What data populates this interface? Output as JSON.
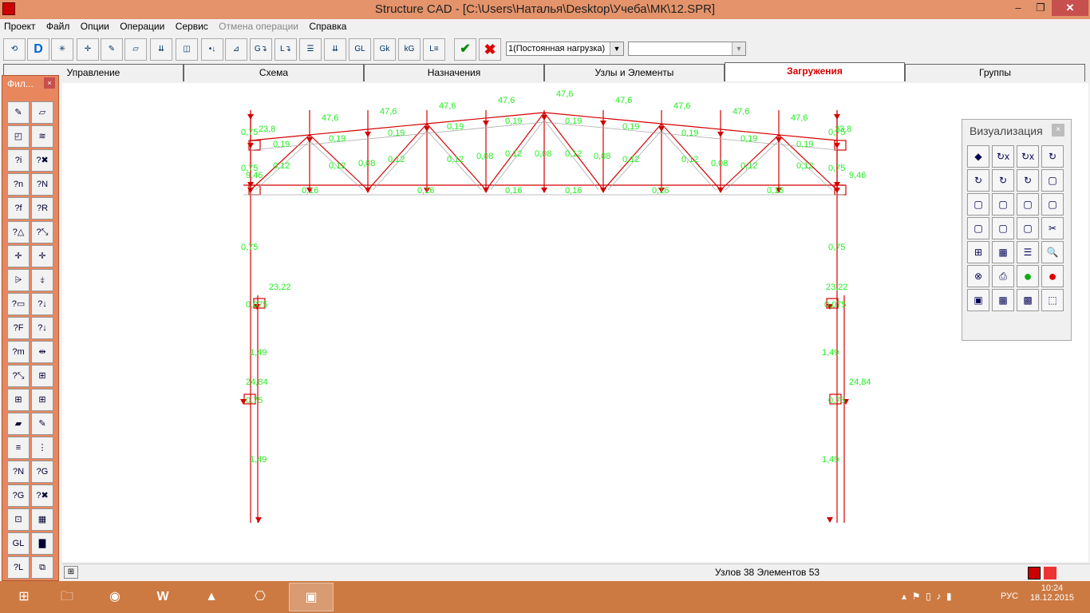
{
  "window": {
    "title": "Structure CAD  - [C:\\Users\\Наталья\\Desktop\\Учеба\\МК\\12.SPR]",
    "minimize": "–",
    "maximize": "❐",
    "close": "✕"
  },
  "menu": [
    "Проект",
    "Файл",
    "Опции",
    "Операции",
    "Сервис",
    "Отмена операции",
    "Справка"
  ],
  "toolbar": {
    "load_case": "1(Постоянная нагрузка)",
    "second_combo": "",
    "buttons": [
      "rotate-icon",
      "D",
      "m",
      "node",
      "pencil",
      "plane",
      "load",
      "beam",
      "node-load",
      "axis",
      "G",
      "L",
      "stack",
      "stack2",
      "GL",
      "Gk",
      "kG",
      "LF",
      "ok",
      "cancel"
    ]
  },
  "tabs": [
    "Управление",
    "Схема",
    "Назначения",
    "Узлы и Элементы",
    "Загружения",
    "Группы"
  ],
  "active_tab": "Загружения",
  "filters_panel": {
    "title": "Фил...",
    "close": "×"
  },
  "viz_panel": {
    "title": "Визуализация",
    "close": "×"
  },
  "status": {
    "text": "Узлов 38 Элементов 53"
  },
  "taskbar": {
    "time": "10:24",
    "date": "18.12.2015",
    "lang": "РУС"
  },
  "scheme_labels": {
    "top_loads": [
      "47,6",
      "47,6",
      "47,6",
      "47,6",
      "47,6",
      "47,6",
      "47,6",
      "47,6",
      "47,6"
    ],
    "end_loads": [
      "23,8",
      "23,8"
    ],
    "top_chord": [
      "0,19",
      "0,19",
      "0,19",
      "0,19",
      "0,19",
      "0,19",
      "0,19",
      "0,19",
      "0,19",
      "0,19"
    ],
    "diagonals": [
      "0,12",
      "0,12",
      "0,08",
      "0,12",
      "0,12",
      "0,08",
      "0,12",
      "0,08",
      "0,12",
      "0,08",
      "0,12",
      "0,12",
      "0,08",
      "0,12",
      "0,12"
    ],
    "bottom_chord": [
      "0,16",
      "0,16",
      "0,16",
      "0,16",
      "0,16",
      "0,16"
    ],
    "side": [
      "0,75",
      "0,75",
      "9,46",
      "9,46",
      "0,75",
      "0,75",
      "0,75",
      "0,75"
    ],
    "columns": [
      "23,22",
      "23,22",
      "0,075",
      "0,075",
      "1,49",
      "1,49",
      "24,84",
      "24,84",
      "0,75",
      "0,75",
      "1,49",
      "1,49"
    ]
  },
  "colors": {
    "title_bar": "#e4936b",
    "scheme_line": "#d40000",
    "label": "#22ee22",
    "taskbar": "#cc7a42"
  }
}
